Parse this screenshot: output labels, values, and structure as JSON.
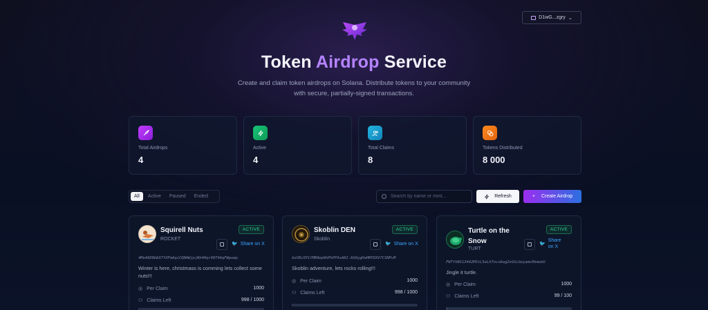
{
  "header": {
    "wallet_label": "D1wG...zgry"
  },
  "hero": {
    "title_part1": "Token",
    "title_accent": "Airdrop",
    "title_part2": "Service",
    "subtitle": "Create and claim token airdrops on Solana. Distribute tokens to your community with secure, partially-signed transactions."
  },
  "stats": [
    {
      "label": "Total Airdrops",
      "value": "4",
      "color": "#b12cf0"
    },
    {
      "label": "Active",
      "value": "4",
      "color": "#14b86a"
    },
    {
      "label": "Total Claims",
      "value": "8",
      "color": "#1aa3d6"
    },
    {
      "label": "Tokens Distributed",
      "value": "8 000",
      "color": "#f57c14"
    }
  ],
  "toolbar": {
    "tabs": [
      "All",
      "Active",
      "Paused",
      "Ended"
    ],
    "active_tab": "All",
    "search_placeholder": "Search by name or mint...",
    "refresh_label": "Refresh",
    "create_label": "Create Airdrop"
  },
  "airdrops": [
    {
      "name": "Squirell Nuts",
      "symbol": "ROCKET",
      "status": "ACTIVE",
      "share": "Share on X",
      "mint": "4Mo46D0b6X7YXFmAqiCQNAWjpjNh4Hqr99T4AqFWpump",
      "description": "Winter is here, christmass is comming lets collect some nuts!!!",
      "per_claim_label": "Per Claim",
      "per_claim": "1000",
      "claims_left_label": "Claims Left",
      "claims_left": "998 / 1000",
      "progress": 0.002
    },
    {
      "name": "Skoblin DEN",
      "symbol": "Skoblin",
      "status": "ACTIVE",
      "share": "Share on X",
      "mint": "GeSBv5P1fMB9mp9hPhPFAsA6I.6hDygHaHMYDXV7CSNPvM",
      "description": "Skoblin adventure, lets rocks rolling!!!",
      "per_claim_label": "Per Claim",
      "per_claim": "1000",
      "claims_left_label": "Claims Left",
      "claims_left": "998 / 1000",
      "progress": 0.002
    },
    {
      "name": "Turtle on the Snow",
      "symbol": "TURT",
      "status": "ACTIVE",
      "share": "Share on X",
      "mint": "FWTfhNS13442MStL5eLhTnvs6wgZxGScGeyamcRkmobU",
      "description": "Jingle it turtle.",
      "per_claim_label": "Per Claim",
      "per_claim": "1000",
      "claims_left_label": "Claims Left",
      "claims_left": "99 / 100",
      "progress": 0.01
    }
  ]
}
